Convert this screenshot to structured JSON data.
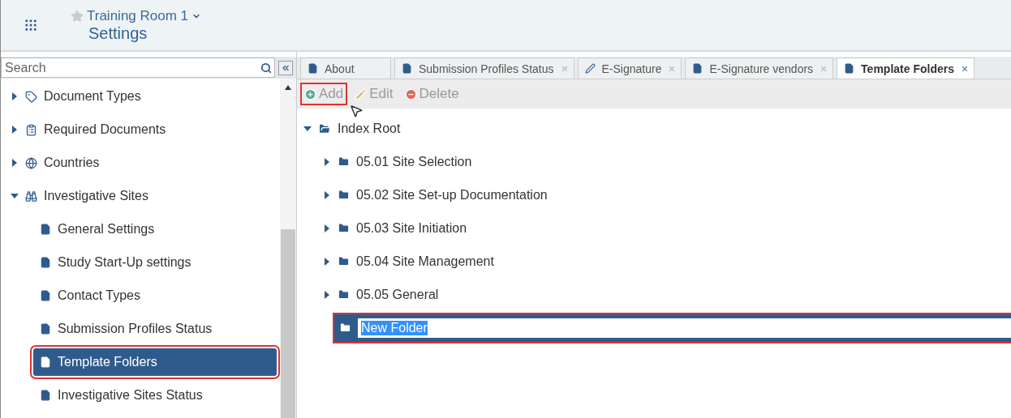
{
  "header": {
    "room": "Training Room 1",
    "title": "Settings"
  },
  "search": {
    "placeholder": "Search"
  },
  "sidebar": {
    "items": [
      {
        "label": "Document Types",
        "kind": "tag",
        "expanded": false,
        "selected": false,
        "highlighted": false
      },
      {
        "label": "Required Documents",
        "kind": "clipboard",
        "expanded": false,
        "selected": false,
        "highlighted": false
      },
      {
        "label": "Countries",
        "kind": "globe",
        "expanded": false,
        "selected": false,
        "highlighted": false
      },
      {
        "label": "Investigative Sites",
        "kind": "binoculars",
        "expanded": true,
        "selected": false,
        "highlighted": false,
        "children": [
          {
            "label": "General Settings",
            "kind": "page",
            "selected": false,
            "highlighted": false
          },
          {
            "label": "Study Start-Up settings",
            "kind": "page",
            "selected": false,
            "highlighted": false
          },
          {
            "label": "Contact Types",
            "kind": "page",
            "selected": false,
            "highlighted": false
          },
          {
            "label": "Submission Profiles Status",
            "kind": "page",
            "selected": false,
            "highlighted": false
          },
          {
            "label": "Template Folders",
            "kind": "page",
            "selected": true,
            "highlighted": true
          },
          {
            "label": "Investigative Sites Status",
            "kind": "page",
            "selected": false,
            "highlighted": false
          }
        ]
      }
    ]
  },
  "tabs": [
    {
      "label": "About",
      "kind": "page",
      "closable": false,
      "selected": false
    },
    {
      "label": "Submission Profiles Status",
      "kind": "page",
      "closable": true,
      "selected": false
    },
    {
      "label": "E-Signature",
      "kind": "pen",
      "closable": true,
      "selected": false
    },
    {
      "label": "E-Signature vendors",
      "kind": "page",
      "closable": true,
      "selected": false
    },
    {
      "label": "Template Folders",
      "kind": "page",
      "closable": true,
      "selected": true
    }
  ],
  "toolbar": [
    {
      "label": "Add",
      "kind": "add",
      "highlighted": true
    },
    {
      "label": "Edit",
      "kind": "edit",
      "highlighted": false
    },
    {
      "label": "Delete",
      "kind": "delete",
      "highlighted": false
    }
  ],
  "tree": {
    "label": "Index Root",
    "expanded": true,
    "children": [
      {
        "label": "05.01 Site Selection",
        "kind": "folder",
        "expanded": false,
        "highlighted": false
      },
      {
        "label": "05.02 Site Set-up Documentation",
        "kind": "folder",
        "expanded": false,
        "highlighted": false
      },
      {
        "label": "05.03 Site Initiation",
        "kind": "folder",
        "expanded": false,
        "highlighted": false
      },
      {
        "label": "05.04 Site Management",
        "kind": "folder",
        "expanded": false,
        "highlighted": false
      },
      {
        "label": "05.05 General",
        "kind": "folder",
        "expanded": false,
        "highlighted": false
      },
      {
        "label": "New Folder",
        "kind": "editing",
        "highlighted": true
      }
    ]
  }
}
